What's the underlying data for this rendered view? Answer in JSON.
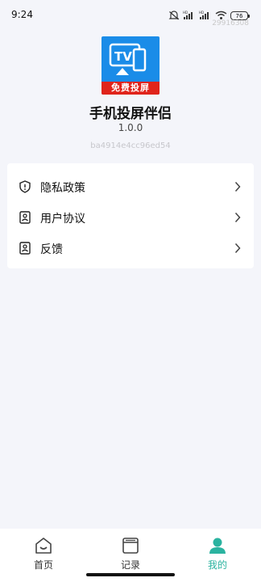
{
  "status_bar": {
    "time": "9:24",
    "battery": "76",
    "number": "29916308"
  },
  "app": {
    "logo_band_text": "免费投屏",
    "logo_tv_text": "TV",
    "name": "手机投屏伴侣",
    "version": "1.0.0",
    "build_hash": "ba4914e4cc96ed54"
  },
  "menu": {
    "items": [
      {
        "label": "隐私政策",
        "icon": "shield-icon"
      },
      {
        "label": "用户协议",
        "icon": "document-person-icon"
      },
      {
        "label": "反馈",
        "icon": "feedback-icon"
      }
    ]
  },
  "bottom_nav": {
    "items": [
      {
        "label": "首页",
        "icon": "home-icon",
        "active": false
      },
      {
        "label": "记录",
        "icon": "records-icon",
        "active": false
      },
      {
        "label": "我的",
        "icon": "profile-icon",
        "active": true
      }
    ]
  },
  "colors": {
    "accent": "#2bb3a0",
    "background": "#f4f5fa",
    "logo_blue": "#1a8ce8",
    "logo_red": "#e0241b"
  }
}
